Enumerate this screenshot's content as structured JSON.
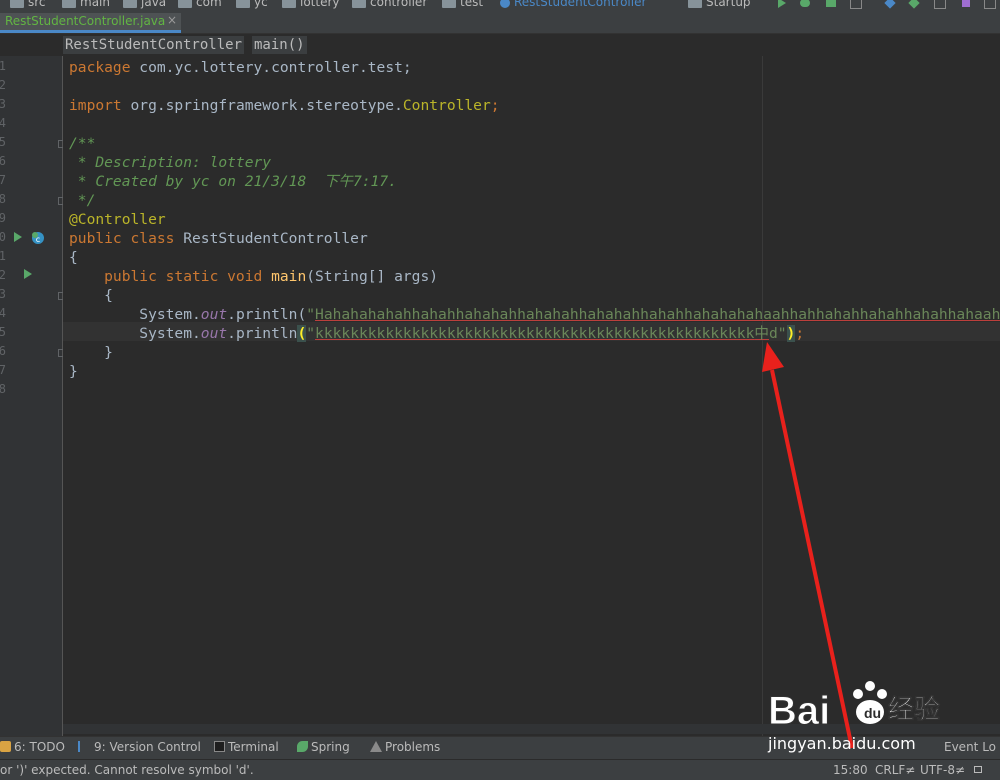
{
  "navbar": {
    "crumbs": [
      "src",
      "main",
      "java",
      "com",
      "yc",
      "lottery",
      "controller",
      "test",
      "RestStudentController"
    ],
    "run_config": "Startup"
  },
  "tab": {
    "label": "RestStudentController.java",
    "close": "×"
  },
  "breadcrumbs": [
    "RestStudentController",
    "main()"
  ],
  "line_numbers": [
    "1",
    "2",
    "3",
    "4",
    "5",
    "6",
    "7",
    "8",
    "9",
    "0",
    "1",
    "2",
    "3",
    "4",
    "5",
    "6",
    "7",
    "8"
  ],
  "code": {
    "l1_kw": "package",
    "l1_rest": " com.yc.lottery.controller.test;",
    "l3_kw": "import",
    "l3_mid": " org.springframework.stereotype.",
    "l3_cls": "Controller",
    "l3_semi": ";",
    "l5": "/**",
    "l6": " * Description: lottery",
    "l7": " * Created by yc on 21/3/18  下午7:17.",
    "l8": " */",
    "l9": "@Controller",
    "l10_kw": "public class",
    "l10_rest": " RestStudentController",
    "l11": "{",
    "l12_kw": "    public static void",
    "l12_fn": " main",
    "l12_rest": "(String[] args)",
    "l13": "    {",
    "l14_a": "        System.",
    "l14_out": "out",
    "l14_b": ".println(",
    "l14_q": "\"",
    "l14_str": "Hahahahahahhahahhahahahhahahahhahahahhahahhahahahahaahhahhahahhahahhahahhahaahahahhahahal",
    "l15_a": "        System.",
    "l15_out": "out",
    "l15_b": ".println",
    "l15_paren1": "(",
    "l15_q": "\"",
    "l15_str": "kkkkkkkkkkkkkkkkkkkkkkkkkkkkkkkkkkkkkkkkkkkkkkkkkk",
    "l15_zh": "中",
    "l15_tail": "d\"",
    "l15_paren2": ")",
    "l15_semi": ";",
    "l16": "    }",
    "l17": "}"
  },
  "toolwindows": {
    "todo": "6: TODO",
    "vcs": "9: Version Control",
    "terminal": "Terminal",
    "spring": "Spring",
    "problems": "Problems",
    "event_log": "Event Lo"
  },
  "status": {
    "message": "or ')' expected. Cannot resolve symbol 'd'.",
    "position": "15:80",
    "line_sep": "CRLF≠",
    "encoding": "UTF-8≠"
  },
  "watermark": {
    "brand": "Bai du 经验",
    "url": "jingyan.baidu.com"
  },
  "colors": {
    "annotation_arrow": "#e8211c",
    "tab_underline": "#4a88c7",
    "error_underline": "#bc3f3c"
  }
}
